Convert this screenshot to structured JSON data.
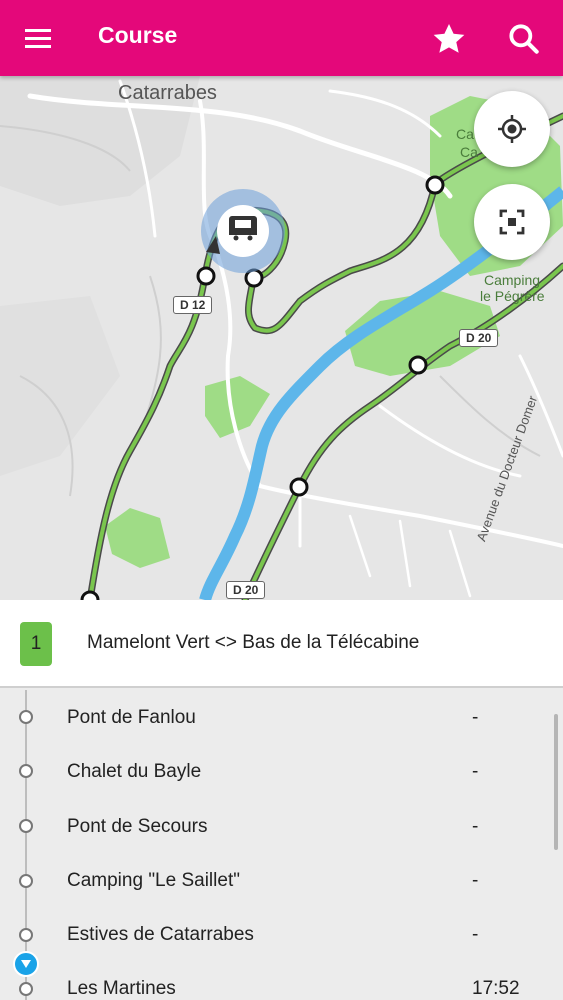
{
  "appbar": {
    "title": "Course",
    "icons": [
      "menu-icon",
      "star-icon",
      "search-icon"
    ],
    "color": "#e4087a"
  },
  "map": {
    "place_labels": {
      "village": "Catarrabes",
      "camping_top_partial": "Ca",
      "camping_top_partial_2": "Ca",
      "camping_name_1": "Camping",
      "camping_name_2": "le Pégrère",
      "street": "Avenue du Docteur Domer"
    },
    "road_badges": {
      "d12": "D 12",
      "d20_upper": "D 20",
      "d20_lower": "D 20"
    },
    "buttons": [
      "locate-icon",
      "fit-route-icon"
    ],
    "route_color": "#5aa23c",
    "river_color": "#5db6ea"
  },
  "route": {
    "number": "1",
    "name": "Mamelont Vert <> Bas de la Télécabine",
    "badge_color": "#6cc04a"
  },
  "stops": [
    {
      "name": "Pont de Fanlou",
      "time": "-"
    },
    {
      "name": "Chalet du Bayle",
      "time": "-"
    },
    {
      "name": "Pont de Secours",
      "time": "-"
    },
    {
      "name": "Camping \"Le Saillet\"",
      "time": "-"
    },
    {
      "name": "Estives de Catarrabes",
      "time": "-"
    },
    {
      "name": "Les Martines",
      "time": "17:52"
    }
  ]
}
